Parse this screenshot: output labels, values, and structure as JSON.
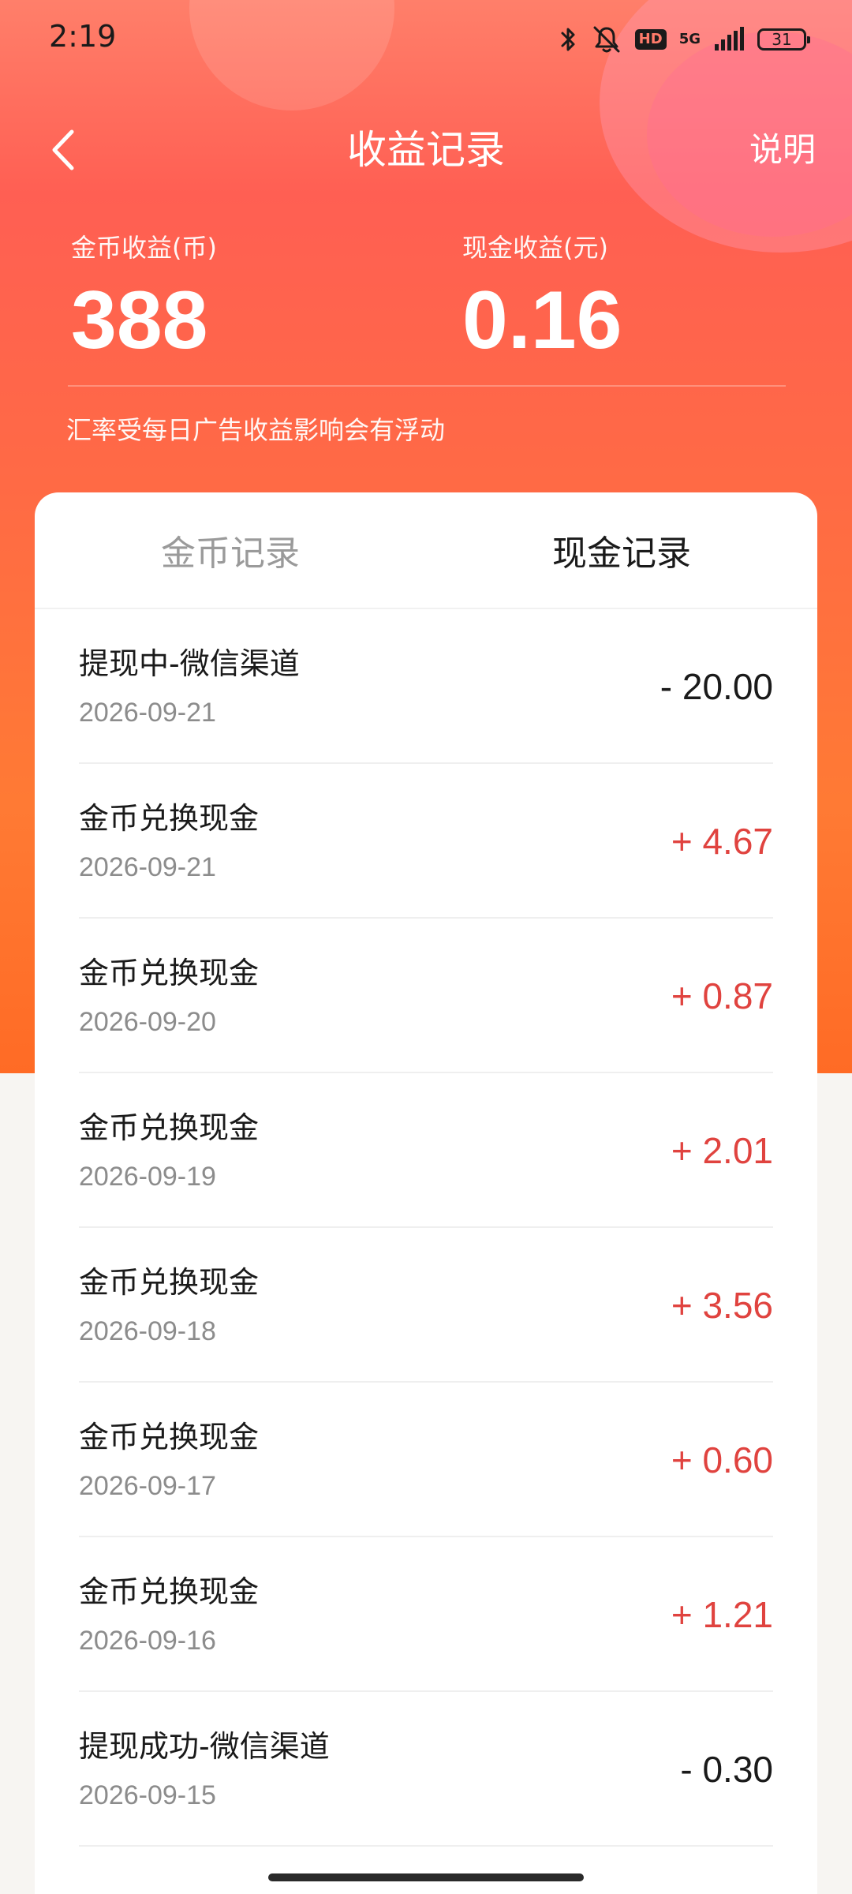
{
  "status_bar": {
    "time": "2:19",
    "icons": [
      "bluetooth-icon",
      "mute-icon",
      "hd-icon",
      "5g-icon",
      "signal-icon",
      "battery-icon"
    ],
    "hd_label": "HD",
    "network_label": "5G",
    "battery_level": "31"
  },
  "header": {
    "title": "收益记录",
    "explain_label": "说明",
    "back_icon": "chevron-left-icon"
  },
  "stats": {
    "coin_label": "金币收益(币)",
    "coin_value": "388",
    "cash_label": "现金收益(元)",
    "cash_value": "0.16",
    "note": "汇率受每日广告收益影响会有浮动"
  },
  "tabs": [
    {
      "label": "金币记录",
      "active": false
    },
    {
      "label": "现金记录",
      "active": true
    }
  ],
  "records": [
    {
      "title": "提现中-微信渠道",
      "date": "2026-09-21",
      "amount": "- 20.00",
      "type": "debit"
    },
    {
      "title": "金币兑换现金",
      "date": "2026-09-21",
      "amount": "+ 4.67",
      "type": "credit"
    },
    {
      "title": "金币兑换现金",
      "date": "2026-09-20",
      "amount": "+ 0.87",
      "type": "credit"
    },
    {
      "title": "金币兑换现金",
      "date": "2026-09-19",
      "amount": "+ 2.01",
      "type": "credit"
    },
    {
      "title": "金币兑换现金",
      "date": "2026-09-18",
      "amount": "+ 3.56",
      "type": "credit"
    },
    {
      "title": "金币兑换现金",
      "date": "2026-09-17",
      "amount": "+ 0.60",
      "type": "credit"
    },
    {
      "title": "金币兑换现金",
      "date": "2026-09-16",
      "amount": "+ 1.21",
      "type": "credit"
    },
    {
      "title": "提现成功-微信渠道",
      "date": "2026-09-15",
      "amount": "- 0.30",
      "type": "debit"
    }
  ],
  "colors": {
    "credit": "#e0433f",
    "debit": "#1a1a1a",
    "accent": "#ff6a45"
  }
}
